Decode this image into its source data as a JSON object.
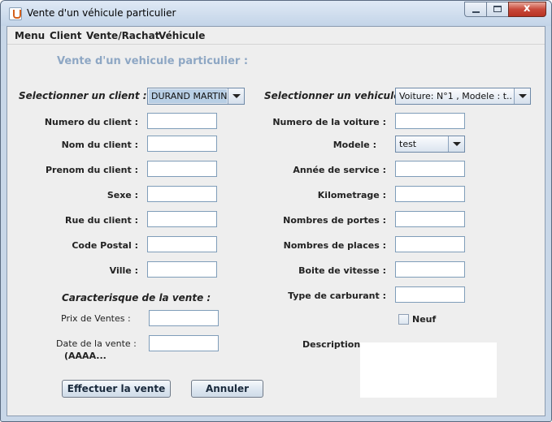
{
  "window": {
    "title": "Vente d'un véhicule particulier",
    "controls": {
      "minimize_icon": "minimize-icon",
      "maximize_icon": "maximize-icon",
      "close_glyph": "x"
    }
  },
  "menu": [
    "Menu",
    "Client",
    "Vente/Rachat",
    "Véhicule"
  ],
  "form": {
    "heading": "Vente d'un vehicule particulier :",
    "client": {
      "select_label": "Selectionner un client :",
      "selected_client": "DURAND MARTIN",
      "fields": [
        {
          "label": "Numero du client :",
          "value": ""
        },
        {
          "label": "Nom du client :",
          "value": ""
        },
        {
          "label": "Prenom du client :",
          "value": ""
        },
        {
          "label": "Sexe :",
          "value": ""
        },
        {
          "label": "Rue du client :",
          "value": ""
        },
        {
          "label": "Code Postal :",
          "value": ""
        },
        {
          "label": "Ville :",
          "value": ""
        }
      ]
    },
    "vehicle": {
      "select_label": "Selectionner un vehicule :",
      "selected_vehicle": "Voiture: N°1 , Modele : t...",
      "fields": [
        {
          "label": "Numero de la voiture :",
          "value": ""
        },
        {
          "label": "Modele :",
          "value": "test"
        },
        {
          "label": "Année de service :",
          "value": ""
        },
        {
          "label": "Kilometrage :",
          "value": ""
        },
        {
          "label": "Nombres de portes :",
          "value": ""
        },
        {
          "label": "Nombres de places :",
          "value": ""
        },
        {
          "label": "Boite de vitesse :",
          "value": ""
        },
        {
          "label": "Type de carburant :",
          "value": ""
        }
      ],
      "neuf_label": "Neuf",
      "neuf_checked": false,
      "description_label": "Description :",
      "description_value": ""
    },
    "sale": {
      "section_label": "Caracterisque de la vente :",
      "price_label": "Prix de Ventes :",
      "price_value": "",
      "date_label_line1": "Date de la vente :",
      "date_label_line2": "(AAAA...",
      "date_value": ""
    },
    "buttons": {
      "submit": "Effectuer la vente",
      "cancel": "Annuler"
    }
  },
  "colors": {
    "heading": "#8ea7c4",
    "window_frame": "#c8d7e8",
    "panel": "#eeeeee",
    "close_button": "#c8493a"
  }
}
